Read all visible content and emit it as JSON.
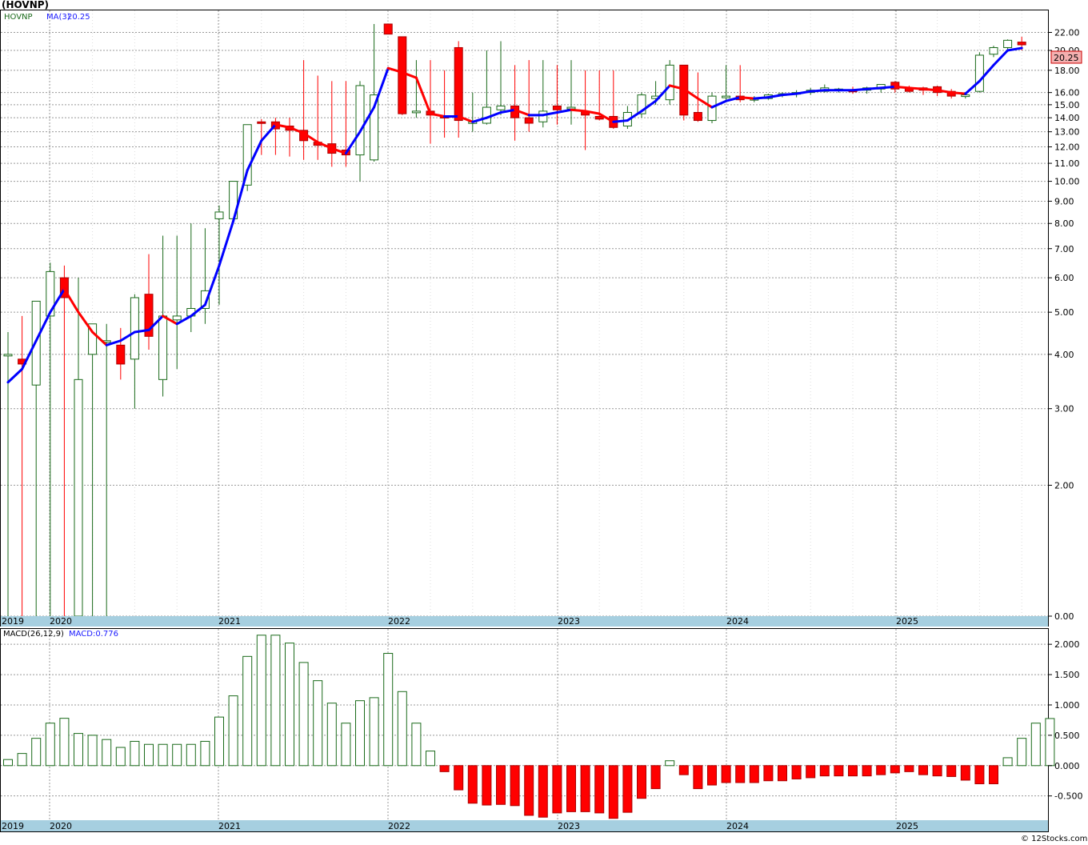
{
  "title": "(HOVNP)",
  "legend": {
    "symbol": "HOVNP",
    "ma_label": "MA(3)",
    "ma_value": "20.25"
  },
  "macd_legend": {
    "label": "MACD(26,12,9)",
    "value_label": "MACD:0.776"
  },
  "last_price_tag": "20.25",
  "copyright": "© 12Stocks.com",
  "colors": {
    "up": "#1a6a1a",
    "down": "#ff0000",
    "ma_up": "#0000ff",
    "ma_down": "#ff0000",
    "axisband": "#a6cfe0",
    "grid": "#999999"
  },
  "chart_data": [
    {
      "type": "candlestick",
      "scale": "log",
      "ylim": [
        0,
        22
      ],
      "y_ticks": [
        "22.00",
        "20.00",
        "18.00",
        "16.00",
        "15.00",
        "14.00",
        "13.00",
        "12.00",
        "11.00",
        "10.00",
        "9.00",
        "8.00",
        "7.00",
        "6.00",
        "5.00",
        "4.00",
        "3.00",
        "2.00",
        "0.00"
      ],
      "x_labels": [
        "2019",
        "2020",
        "2021",
        "2022",
        "2023",
        "2024",
        "2025"
      ],
      "series": [
        {
          "name": "HOVNP",
          "candles": [
            [
              4.0,
              4.5,
              0.5,
              4.0
            ],
            [
              3.9,
              4.9,
              0.5,
              3.8
            ],
            [
              3.4,
              5.3,
              0.5,
              5.3
            ],
            [
              4.9,
              6.5,
              0.5,
              6.2
            ],
            [
              6.0,
              6.4,
              0.5,
              5.4
            ],
            [
              0.5,
              6.0,
              0.5,
              3.5
            ],
            [
              4.0,
              4.7,
              0.5,
              4.7
            ],
            [
              4.3,
              4.7,
              0.5,
              4.3
            ],
            [
              4.2,
              4.6,
              3.5,
              3.8
            ],
            [
              3.9,
              5.5,
              3.0,
              5.4
            ],
            [
              5.5,
              6.8,
              4.1,
              4.4
            ],
            [
              3.5,
              7.5,
              3.2,
              4.9
            ],
            [
              4.8,
              7.5,
              3.7,
              4.9
            ],
            [
              4.9,
              8.0,
              4.5,
              5.1
            ],
            [
              5.1,
              7.8,
              4.7,
              5.6
            ],
            [
              8.2,
              8.8,
              5.2,
              8.5
            ],
            [
              8.2,
              10.0,
              8.0,
              10.0
            ],
            [
              9.8,
              13.5,
              9.5,
              13.5
            ],
            [
              13.7,
              13.9,
              11.5,
              13.6
            ],
            [
              13.7,
              14.0,
              11.5,
              13.2
            ],
            [
              13.4,
              14.0,
              11.4,
              13.1
            ],
            [
              13.1,
              19.0,
              11.2,
              12.4
            ],
            [
              12.3,
              17.5,
              11.2,
              12.1
            ],
            [
              12.2,
              17.0,
              10.8,
              11.6
            ],
            [
              11.8,
              17.0,
              10.8,
              11.5
            ],
            [
              11.5,
              17.0,
              10.0,
              16.6
            ],
            [
              11.2,
              23.0,
              11.1,
              15.8
            ],
            [
              23.0,
              23.0,
              22.0,
              21.8
            ],
            [
              21.5,
              21.5,
              14.2,
              14.3
            ],
            [
              14.5,
              19.0,
              14.0,
              14.5
            ],
            [
              14.5,
              19.0,
              12.2,
              14.2
            ],
            [
              14.1,
              18.0,
              12.6,
              14.0
            ],
            [
              20.3,
              21.0,
              12.6,
              13.8
            ],
            [
              13.6,
              16.0,
              13.0,
              13.7
            ],
            [
              13.6,
              20.0,
              13.5,
              14.8
            ],
            [
              14.6,
              21.0,
              14.2,
              14.9
            ],
            [
              14.9,
              18.5,
              12.4,
              14.0
            ],
            [
              14.0,
              19.0,
              13.0,
              13.6
            ],
            [
              13.7,
              19.0,
              13.3,
              14.5
            ],
            [
              14.9,
              18.5,
              13.5,
              14.6
            ],
            [
              14.7,
              19.0,
              13.5,
              14.8
            ],
            [
              14.5,
              18.0,
              11.8,
              14.2
            ],
            [
              14.1,
              18.0,
              13.8,
              13.9
            ],
            [
              14.1,
              18.0,
              13.2,
              13.3
            ],
            [
              13.4,
              14.9,
              13.2,
              14.4
            ],
            [
              14.3,
              16.0,
              14.0,
              15.8
            ],
            [
              15.5,
              17.0,
              15.0,
              15.7
            ],
            [
              15.4,
              19.0,
              15.0,
              18.5
            ],
            [
              18.5,
              18.5,
              13.8,
              14.2
            ],
            [
              14.4,
              17.8,
              13.7,
              13.8
            ],
            [
              13.8,
              16.0,
              13.6,
              15.7
            ],
            [
              15.7,
              18.5,
              15.2,
              15.7
            ],
            [
              15.7,
              18.5,
              15.2,
              15.4
            ],
            [
              15.5,
              15.7,
              15.2,
              15.5
            ],
            [
              15.5,
              15.9,
              15.4,
              15.8
            ],
            [
              15.8,
              16.0,
              15.6,
              15.9
            ],
            [
              15.9,
              16.2,
              15.6,
              16.0
            ],
            [
              16.0,
              16.4,
              15.8,
              16.2
            ],
            [
              16.1,
              16.7,
              16.0,
              16.4
            ],
            [
              16.2,
              16.4,
              16.0,
              16.3
            ],
            [
              16.2,
              16.5,
              15.9,
              16.1
            ],
            [
              16.2,
              16.5,
              15.9,
              16.4
            ],
            [
              16.3,
              16.6,
              16.0,
              16.7
            ],
            [
              16.9,
              17.0,
              16.0,
              16.3
            ],
            [
              16.4,
              16.6,
              16.0,
              16.1
            ],
            [
              16.4,
              16.5,
              15.8,
              16.2
            ],
            [
              16.5,
              16.6,
              15.7,
              16.0
            ],
            [
              16.1,
              16.3,
              15.5,
              15.7
            ],
            [
              15.7,
              16.0,
              15.5,
              15.8
            ],
            [
              16.1,
              19.8,
              16.0,
              19.5
            ],
            [
              19.6,
              20.5,
              19.3,
              20.3
            ],
            [
              20.3,
              21.2,
              20.0,
              21.1
            ],
            [
              20.9,
              21.5,
              20.0,
              20.6
            ]
          ]
        },
        {
          "name": "MA(3)",
          "values": [
            3.45,
            3.7,
            4.3,
            5.0,
            5.65,
            5.0,
            4.5,
            4.2,
            4.3,
            4.5,
            4.55,
            4.9,
            4.7,
            4.9,
            5.2,
            6.4,
            8.1,
            10.6,
            12.4,
            13.5,
            13.3,
            12.9,
            12.3,
            11.9,
            11.6,
            13.0,
            14.8,
            18.2,
            17.8,
            17.3,
            14.3,
            14.1,
            14.1,
            13.7,
            14.0,
            14.4,
            14.6,
            14.2,
            14.2,
            14.4,
            14.6,
            14.5,
            14.3,
            13.7,
            13.8,
            14.5,
            15.3,
            16.6,
            16.3,
            15.5,
            14.8,
            15.3,
            15.6,
            15.5,
            15.6,
            15.8,
            15.9,
            16.1,
            16.2,
            16.2,
            16.2,
            16.3,
            16.4,
            16.5,
            16.4,
            16.3,
            16.2,
            16.0,
            15.9,
            17.0,
            18.5,
            20.0,
            20.25
          ]
        }
      ]
    },
    {
      "type": "bar",
      "title": "MACD(26,12,9)",
      "ylim": [
        -0.9,
        2.2
      ],
      "y_ticks": [
        "2.000",
        "1.500",
        "1.000",
        "0.500",
        "0.000",
        "-0.500"
      ],
      "x_labels": [
        "2019",
        "2020",
        "2021",
        "2022",
        "2023",
        "2024",
        "2025"
      ],
      "series": [
        {
          "name": "MACD",
          "values": [
            0.1,
            0.2,
            0.45,
            0.7,
            0.78,
            0.53,
            0.5,
            0.43,
            0.3,
            0.4,
            0.35,
            0.35,
            0.35,
            0.35,
            0.4,
            0.8,
            1.15,
            1.8,
            2.15,
            2.15,
            2.02,
            1.7,
            1.4,
            1.03,
            0.7,
            1.07,
            1.12,
            1.85,
            1.22,
            0.7,
            0.24,
            -0.1,
            -0.4,
            -0.62,
            -0.65,
            -0.64,
            -0.66,
            -0.82,
            -0.85,
            -0.78,
            -0.76,
            -0.76,
            -0.78,
            -0.87,
            -0.77,
            -0.54,
            -0.38,
            0.08,
            -0.15,
            -0.38,
            -0.32,
            -0.28,
            -0.28,
            -0.28,
            -0.25,
            -0.25,
            -0.22,
            -0.2,
            -0.17,
            -0.17,
            -0.17,
            -0.17,
            -0.15,
            -0.12,
            -0.1,
            -0.15,
            -0.17,
            -0.18,
            -0.24,
            -0.3,
            -0.3,
            0.13,
            0.45,
            0.7,
            0.776
          ]
        }
      ]
    }
  ]
}
